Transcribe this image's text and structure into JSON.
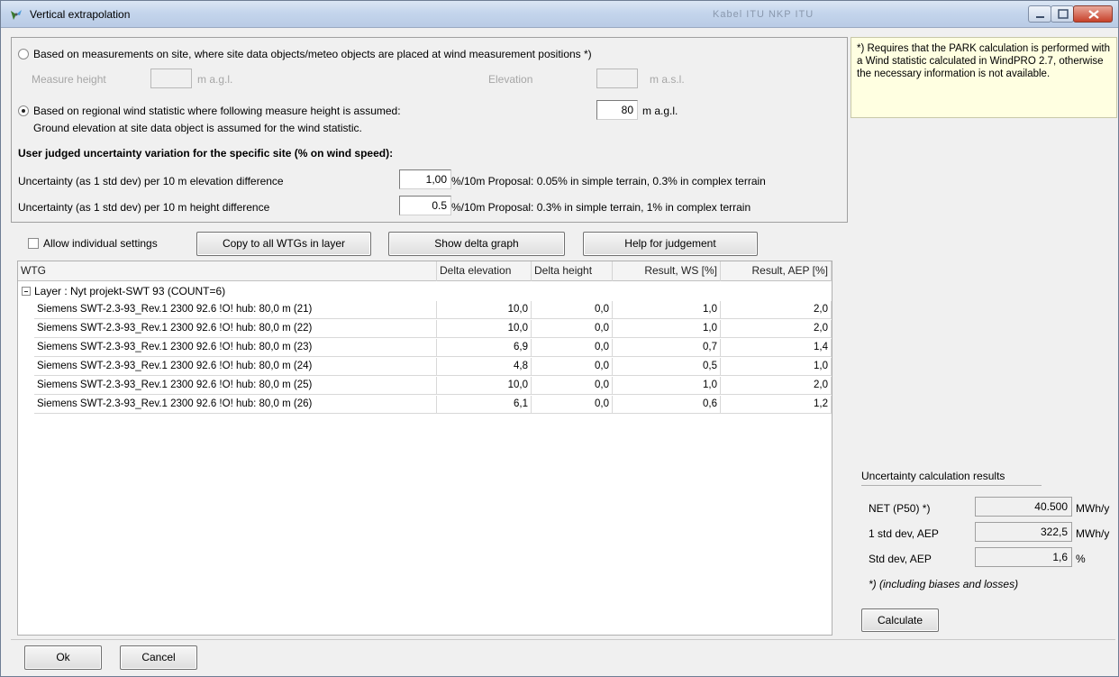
{
  "window": {
    "title": "Vertical extrapolation",
    "title_faint": "Kabel ITU   NKP ITU",
    "icon": "wind-turbine-icon"
  },
  "top": {
    "radio1_label": "Based on measurements on site, where site data objects/meteo objects are placed at wind measurement positions *)",
    "measure_height_label": "Measure height",
    "measure_height_unit": "m a.g.l.",
    "elevation_label": "Elevation",
    "elevation_unit": "m a.s.l.",
    "radio2_label": "Based on regional wind statistic where following measure height is assumed:",
    "assumed_height_value": "80",
    "assumed_height_unit": "m a.g.l.",
    "ground_note": "Ground elevation at site data object is assumed for the wind statistic.",
    "section_heading": "User judged uncertainty variation for the specific site (% on wind speed):",
    "elev_unc_label": "Uncertainty (as 1 std dev) per 10 m elevation difference",
    "elev_unc_value": "1,00",
    "elev_unc_hint": "%/10m Proposal: 0.05% in  simple terrain, 0.3% in complex terrain",
    "height_unc_label": "Uncertainty (as 1 std dev) per 10 m height difference",
    "height_unc_value": "0.5",
    "height_unc_hint": "%/10m Proposal: 0.3% in  simple terrain, 1% in complex terrain"
  },
  "info_note": "*) Requires that the PARK calculation is performed with a Wind statistic calculated in WindPRO 2.7, otherwise the necessary information is not available.",
  "toolbar": {
    "allow_individual_label": "Allow individual settings",
    "copy_button": "Copy to all WTGs in layer",
    "delta_graph_button": "Show delta graph",
    "help_button": "Help for judgement"
  },
  "table": {
    "headers": [
      "WTG",
      "Delta elevation",
      "Delta height",
      "Result, WS [%]",
      "Result, AEP [%]"
    ],
    "layer_label": "Layer : Nyt projekt-SWT 93 (COUNT=6)",
    "rows": [
      {
        "wtg": "Siemens SWT-2.3-93_Rev.1 2300 92.6 !O! hub: 80,0 m (21)",
        "delta_elev": "10,0",
        "delta_height": "0,0",
        "ws": "1,0",
        "aep": "2,0"
      },
      {
        "wtg": "Siemens SWT-2.3-93_Rev.1 2300 92.6 !O! hub: 80,0 m (22)",
        "delta_elev": "10,0",
        "delta_height": "0,0",
        "ws": "1,0",
        "aep": "2,0"
      },
      {
        "wtg": "Siemens SWT-2.3-93_Rev.1 2300 92.6 !O! hub: 80,0 m (23)",
        "delta_elev": "6,9",
        "delta_height": "0,0",
        "ws": "0,7",
        "aep": "1,4"
      },
      {
        "wtg": "Siemens SWT-2.3-93_Rev.1 2300 92.6 !O! hub: 80,0 m (24)",
        "delta_elev": "4,8",
        "delta_height": "0,0",
        "ws": "0,5",
        "aep": "1,0"
      },
      {
        "wtg": "Siemens SWT-2.3-93_Rev.1 2300 92.6 !O! hub: 80,0 m (25)",
        "delta_elev": "10,0",
        "delta_height": "0,0",
        "ws": "1,0",
        "aep": "2,0"
      },
      {
        "wtg": "Siemens SWT-2.3-93_Rev.1 2300 92.6 !O! hub: 80,0 m (26)",
        "delta_elev": "6,1",
        "delta_height": "0,0",
        "ws": "0,6",
        "aep": "1,2"
      }
    ]
  },
  "results": {
    "title": "Uncertainty calculation results",
    "net_label": "NET (P50) *)",
    "net_value": "40.500",
    "net_unit": "MWh/y",
    "std_aep_label": "1 std dev, AEP",
    "std_aep_value": "322,5",
    "std_aep_unit": "MWh/y",
    "std_pct_label": "Std dev, AEP",
    "std_pct_value": "1,6",
    "std_pct_unit": "%",
    "footnote": "*) (including biases and losses)",
    "calculate_button": "Calculate"
  },
  "footer": {
    "ok_button": "Ok",
    "cancel_button": "Cancel"
  }
}
